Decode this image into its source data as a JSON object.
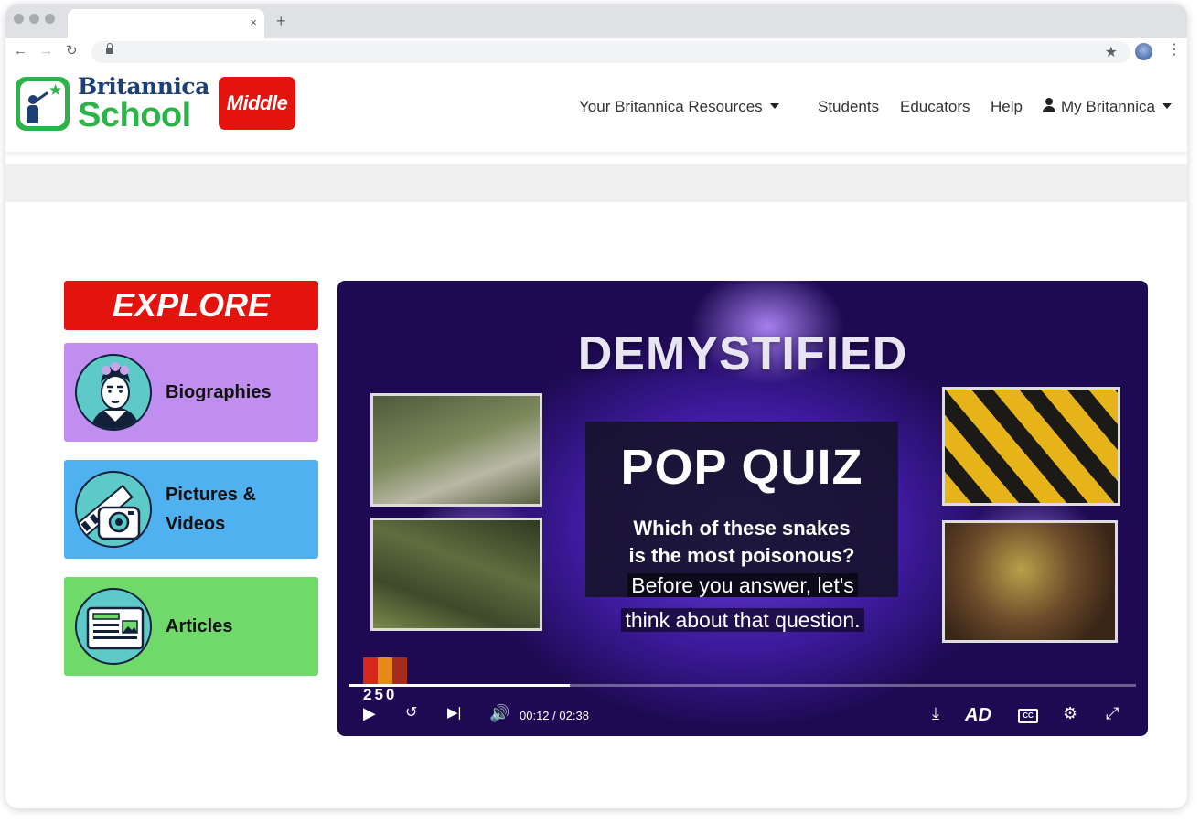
{
  "browser": {
    "tab_close": "×",
    "new_tab": "+",
    "back": "←",
    "forward": "→",
    "reload": "↻",
    "bookmark": "★",
    "menu": "⋮"
  },
  "header": {
    "logo_title": "Britannica",
    "logo_sub": "School",
    "level_badge": "Middle",
    "nav": {
      "resources": "Your Britannica Resources",
      "students": "Students",
      "educators": "Educators",
      "help": "Help",
      "account": "My Britannica"
    }
  },
  "explore": {
    "title": "EXPLORE",
    "cards": [
      {
        "label": "Biographies",
        "color": "#c08df0",
        "icon": "frida-portrait-icon"
      },
      {
        "label_line1": "Pictures &",
        "label_line2": "Videos",
        "color": "#4fb1f0",
        "icon": "camera-film-icon"
      },
      {
        "label": "Articles",
        "color": "#6fd96a",
        "icon": "article-page-icon"
      }
    ]
  },
  "video": {
    "title": "DEMYSTIFIED",
    "quiz_title": "POP QUIZ",
    "quiz_line1": "Which of these snakes",
    "quiz_line2": "is the most poisonous?",
    "caption_line1": "Before you answer, let's",
    "caption_line2": "think about that question.",
    "current_time": "00:12",
    "separator": "/",
    "duration": "02:38",
    "progress_fraction": 0.28,
    "badge_digits": "250",
    "ad_label": "AD",
    "cc_label": "CC"
  }
}
